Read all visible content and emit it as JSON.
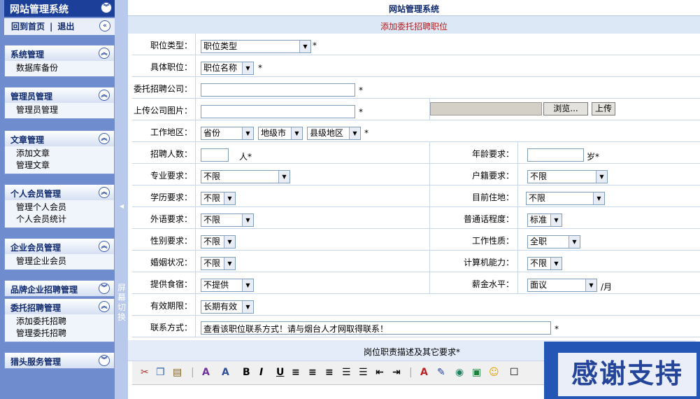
{
  "sidebar": {
    "app_title": "网站管理系统",
    "home_link": "回到首页",
    "logout_link": "退出",
    "groups": [
      {
        "title": "系统管理",
        "items": [
          "数据库备份"
        ]
      },
      {
        "title": "管理员管理",
        "items": [
          "管理员管理"
        ]
      },
      {
        "title": "文章管理",
        "items": [
          "添加文章",
          "管理文章"
        ]
      },
      {
        "title": "个人会员管理",
        "items": [
          "管理个人会员",
          "个人会员统计"
        ]
      },
      {
        "title": "企业会员管理",
        "items": [
          "管理企业会员"
        ]
      },
      {
        "title": "品牌企业招聘管理",
        "items": []
      },
      {
        "title": "委托招聘管理",
        "items": [
          "添加委托招聘",
          "管理委托招聘"
        ]
      },
      {
        "title": "猎头服务管理",
        "items": []
      }
    ],
    "switch_label": "屏幕切换"
  },
  "header": {
    "title": "网站管理系统",
    "subtitle": "添加委托招聘职位"
  },
  "form": {
    "job_type": {
      "label": "职位类型：",
      "value": "职位类型"
    },
    "job_name": {
      "label": "具体职位：",
      "value": "职位名称"
    },
    "company": {
      "label": "委托招聘公司：",
      "value": ""
    },
    "company_image": {
      "label": "上传公司图片：",
      "browse": "浏览...",
      "upload": "上传"
    },
    "work_area": {
      "label": "工作地区：",
      "province": "省份",
      "city": "地级市",
      "county": "县级地区"
    },
    "headcount": {
      "label": "招聘人数：",
      "unit": "人"
    },
    "age": {
      "label": "年龄要求：",
      "unit": "岁"
    },
    "major": {
      "label": "专业要求：",
      "value": "不限"
    },
    "hukou": {
      "label": "户籍要求：",
      "value": "不限"
    },
    "education": {
      "label": "学历要求：",
      "value": "不限"
    },
    "residence": {
      "label": "目前住地：",
      "value": "不限"
    },
    "language": {
      "label": "外语要求：",
      "value": "不限"
    },
    "mandarin": {
      "label": "普通话程度：",
      "value": "标准"
    },
    "gender": {
      "label": "性别要求：",
      "value": "不限"
    },
    "job_nature": {
      "label": "工作性质：",
      "value": "全职"
    },
    "marriage": {
      "label": "婚姻状况：",
      "value": "不限"
    },
    "computer": {
      "label": "计算机能力：",
      "value": "不限"
    },
    "lodging": {
      "label": "提供食宿：",
      "value": "不提供"
    },
    "salary": {
      "label": "薪金水平：",
      "value": "面议",
      "unit": "/月"
    },
    "validity": {
      "label": "有效期限：",
      "value": "长期有效"
    },
    "contact": {
      "label": "联系方式：",
      "value": "查看该职位联系方式！请与烟台人才网取得联系！"
    },
    "description_label": "岗位职责描述及其它要求*"
  },
  "banner_text": "感谢支持",
  "colors": {
    "sidebar_bg": "#6f8ccf",
    "header_bg": "#1c3f9a",
    "subtitle_text": "#b02020"
  }
}
